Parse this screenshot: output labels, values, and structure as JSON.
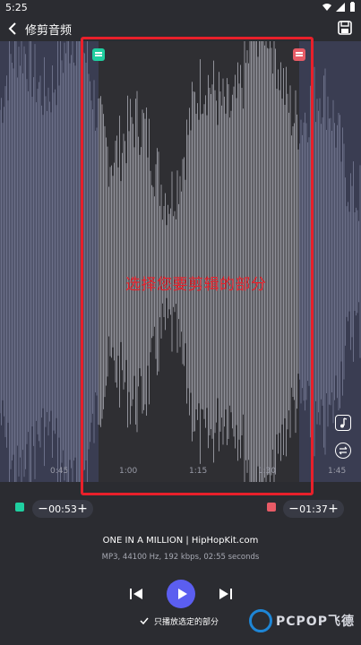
{
  "status_bar": {
    "time": "5:25"
  },
  "app_bar": {
    "title": "修剪音频"
  },
  "waveform": {
    "annotation": "选择您要剪辑的部分",
    "ticks": [
      "0:45",
      "1:00",
      "1:15",
      "1:30",
      "1:45"
    ],
    "colors": {
      "unselected": "#6b6f88",
      "selected": "#8a8b93",
      "selection_bg": "#222327",
      "frame": "#e8202a"
    }
  },
  "trim": {
    "start_time": "00:53",
    "end_time": "01:37",
    "minus": "−",
    "plus": "+"
  },
  "track": {
    "title": "ONE IN A MILLION | HipHopKit.com",
    "meta": "MP3, 44100 Hz, 192 kbps, 02:55 seconds"
  },
  "player": {
    "only_selected_label": "只播放选定的部分",
    "accent": "#5b5ef0"
  },
  "watermark": {
    "text": "PCPOP飞德"
  }
}
